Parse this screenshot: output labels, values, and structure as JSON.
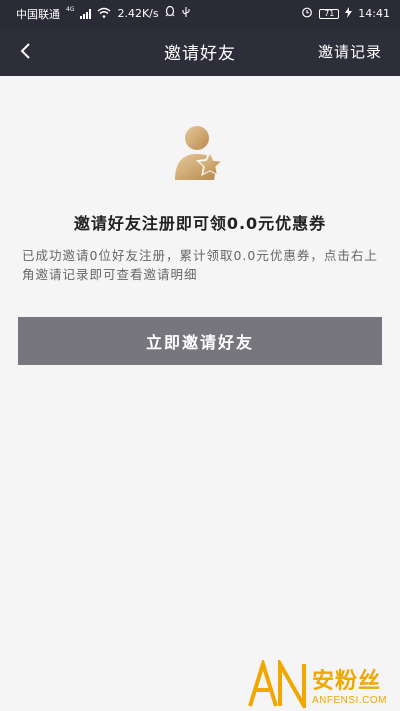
{
  "status_bar": {
    "carrier": "中国联通",
    "network_type": "4G",
    "speed": "2.42K/s",
    "battery": "71",
    "time": "14:41"
  },
  "nav": {
    "title": "邀请好友",
    "action_label": "邀请记录"
  },
  "main": {
    "headline": "邀请好友注册即可领0.0元优惠券",
    "description": "已成功邀请0位好友注册，累计领取0.0元优惠券，点击右上角邀请记录即可查看邀请明细",
    "invite_button_label": "立即邀请好友"
  },
  "watermark": {
    "logo_letters": "AN",
    "brand_cn": "安粉丝",
    "brand_en": "ANFENSI.COM"
  },
  "colors": {
    "header_bg": "#2e2e3b",
    "button_bg": "#77767c",
    "avatar_gold": "#c9a56a",
    "watermark_accent": "#f0a800"
  }
}
